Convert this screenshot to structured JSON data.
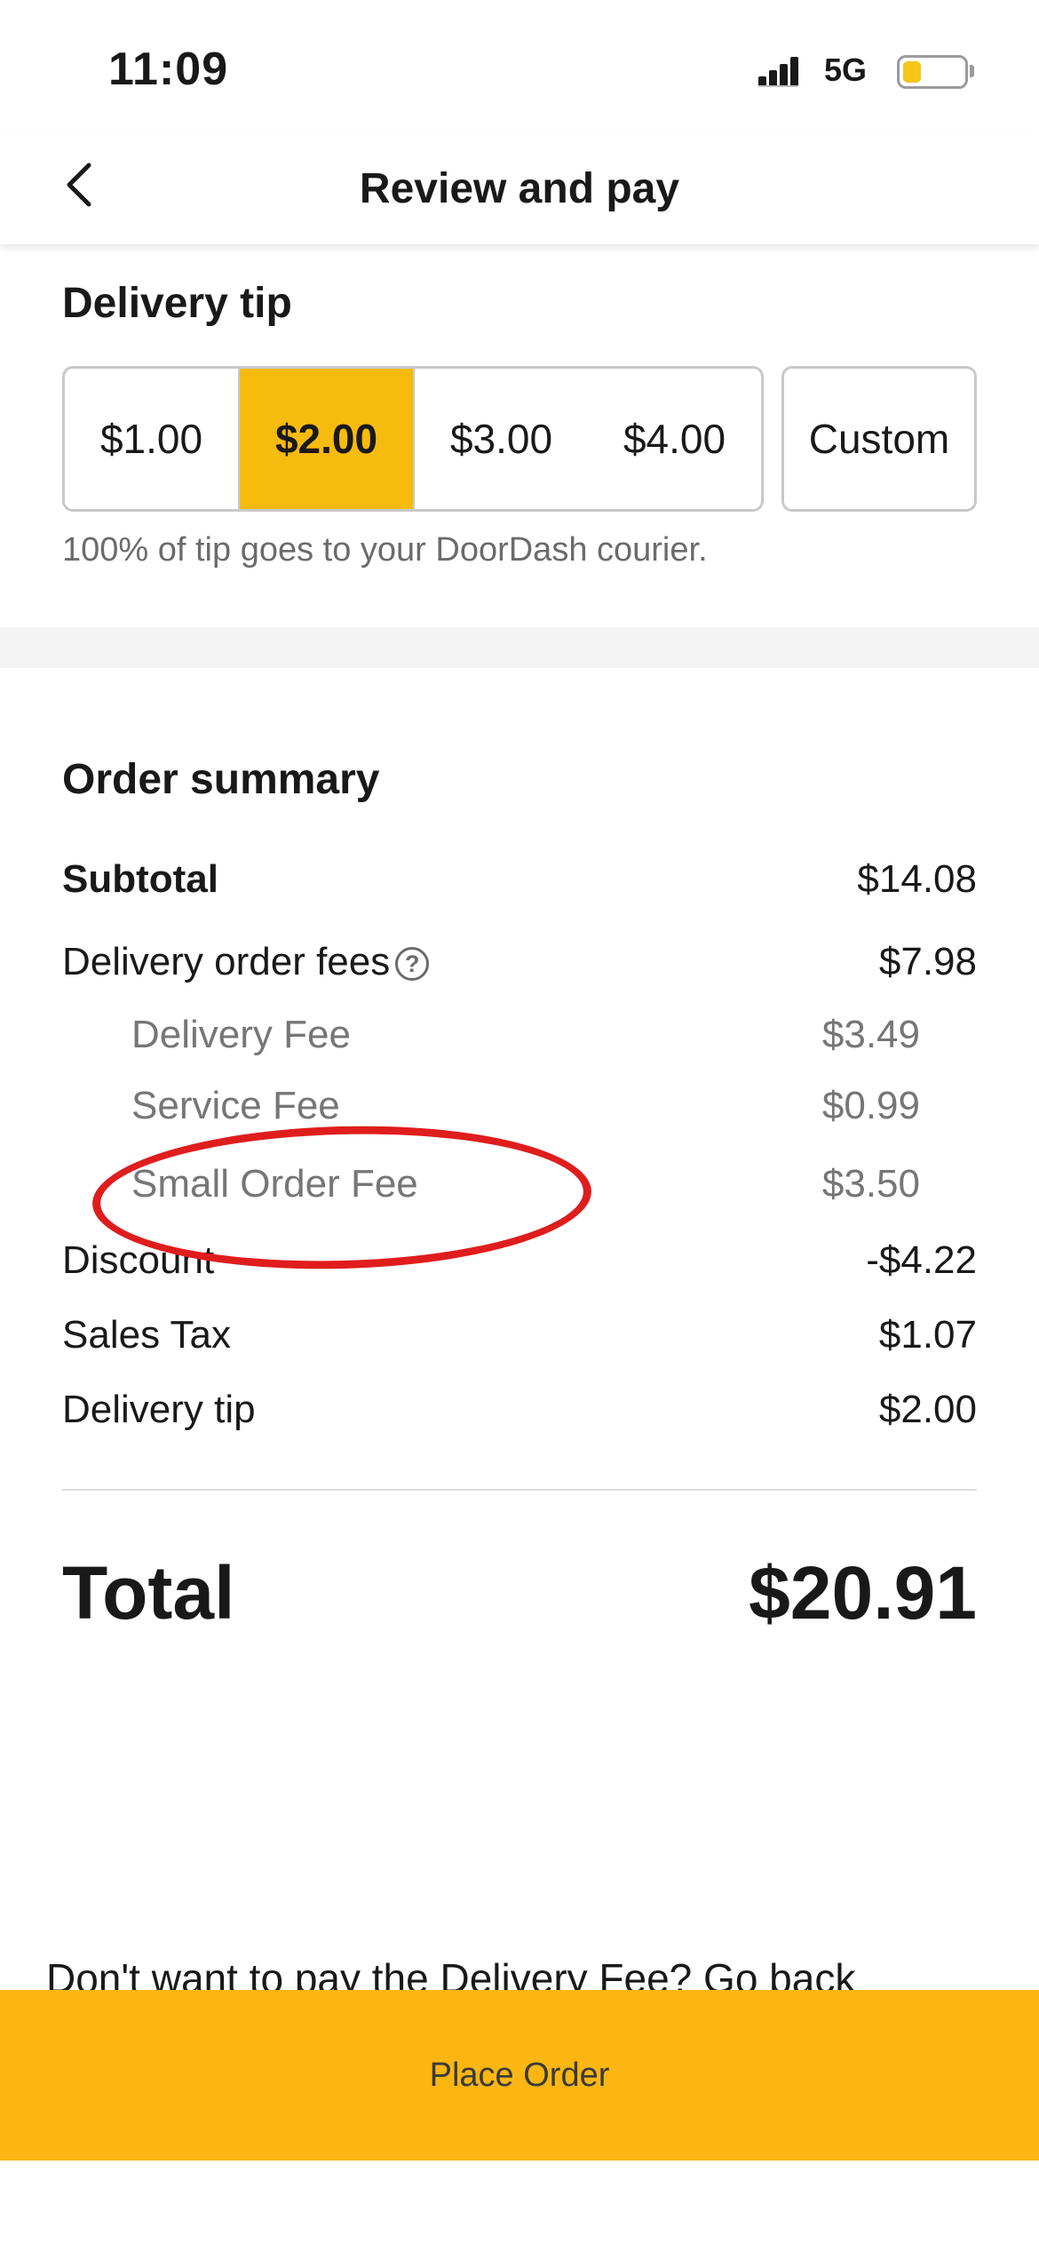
{
  "status_bar": {
    "time": "11:09",
    "network": "5G",
    "battery_color": "#f5c518"
  },
  "header": {
    "title": "Review and pay",
    "back_icon": "chevron-left-icon"
  },
  "tip": {
    "title": "Delivery tip",
    "options": [
      "$1.00",
      "$2.00",
      "$3.00",
      "$4.00"
    ],
    "selected": "$2.00",
    "custom_label": "Custom",
    "note": "100% of tip goes to your DoorDash courier."
  },
  "summary": {
    "title": "Order summary",
    "subtotal": {
      "label": "Subtotal",
      "value": "$14.08"
    },
    "delivery_order_fees": {
      "label": "Delivery order fees",
      "value": "$7.98",
      "info_icon": "help-circle-icon"
    },
    "fees": [
      {
        "label": "Delivery Fee",
        "value": "$3.49"
      },
      {
        "label": "Service Fee",
        "value": "$0.99"
      },
      {
        "label": "Small Order Fee",
        "value": "$3.50"
      }
    ],
    "discount": {
      "label": "Discount",
      "value": "-$4.22"
    },
    "sales_tax": {
      "label": "Sales Tax",
      "value": "$1.07"
    },
    "delivery_tip": {
      "label": "Delivery tip",
      "value": "$2.00"
    },
    "total": {
      "label": "Total",
      "value": "$20.91"
    }
  },
  "annotation": {
    "color": "#e01d1d"
  },
  "promo_text": "Don't want to pay the Delivery Fee? Go back",
  "place_order": {
    "label": "Place Order",
    "color": "#fbb612"
  },
  "accent_color": "#f7bb0d"
}
